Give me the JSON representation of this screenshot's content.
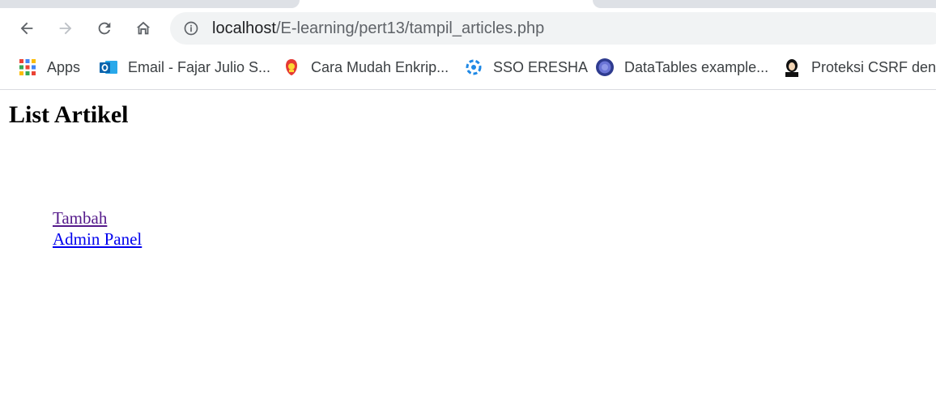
{
  "browser": {
    "url_host": "localhost",
    "url_path": "/E-learning/pert13/tampil_articles.php",
    "bookmarks": [
      {
        "label": "Apps",
        "icon": "apps-grid-icon"
      },
      {
        "label": "Email - Fajar Julio S...",
        "icon": "outlook-icon"
      },
      {
        "label": "Cara Mudah Enkrip...",
        "icon": "site-favicon-icon"
      },
      {
        "label": "SSO ERESHA",
        "icon": "sso-icon"
      },
      {
        "label": "DataTables example...",
        "icon": "datatables-icon"
      },
      {
        "label": "Proteksi CSRF deng",
        "icon": "avatar-favicon-icon"
      }
    ]
  },
  "page": {
    "title": "List Artikel",
    "links": [
      {
        "label": "Tambah",
        "visited": true
      },
      {
        "label": "Admin Panel",
        "visited": false
      }
    ]
  }
}
